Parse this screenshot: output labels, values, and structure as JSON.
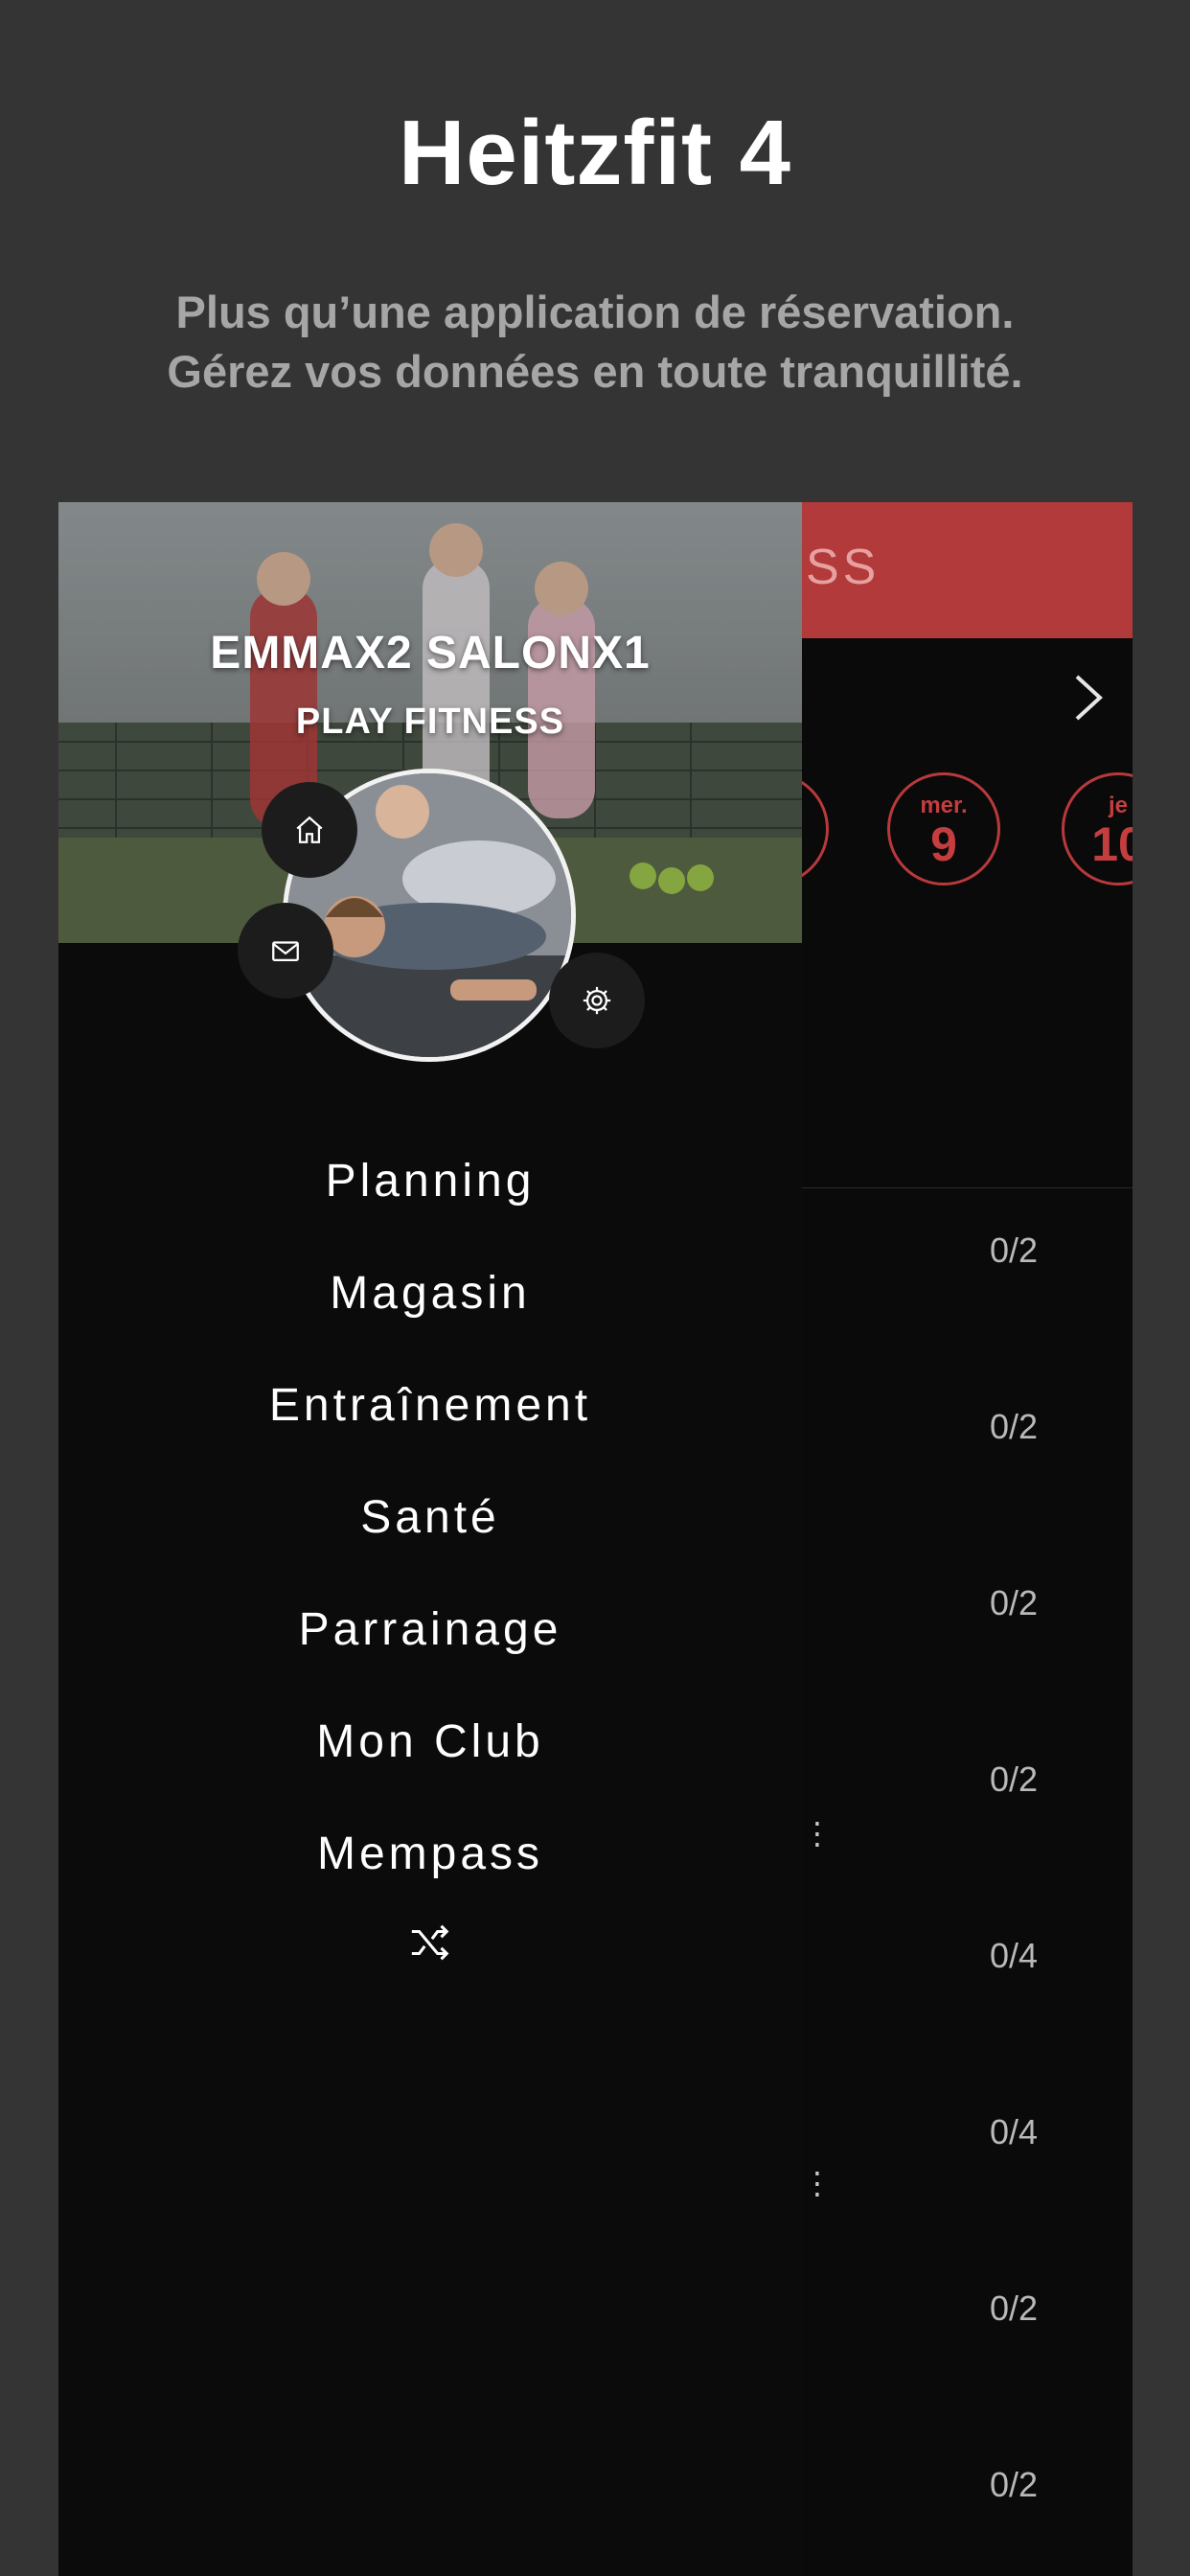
{
  "promo": {
    "title": "Heitzfit 4",
    "subtitle_line1": "Plus qu’une application de réservation.",
    "subtitle_line2": "Gérez vos données en toute tranquillité."
  },
  "app": {
    "header_title_partial": "SS",
    "days": [
      {
        "weekday": "",
        "day": ""
      },
      {
        "weekday": "mer.",
        "day": "9"
      },
      {
        "weekday": "je",
        "day": "10"
      }
    ],
    "slots": [
      "0/2",
      "0/2",
      "0/2",
      "0/2",
      "0/4",
      "0/4",
      "0/2",
      "0/2"
    ]
  },
  "drawer": {
    "user_name": "EMMAX2 SALONX1",
    "club_name": "PLAY FITNESS",
    "menu": [
      "Planning",
      "Magasin",
      "Entraînement",
      "Santé",
      "Parrainage",
      "Mon Club",
      "Mempass"
    ],
    "icons": [
      "home-icon",
      "mail-icon",
      "gear-icon",
      "shuffle-icon"
    ]
  },
  "colors": {
    "background": "#343434",
    "accent": "#b23a3a",
    "drawer": "#0b0b0b",
    "text": "#ffffff",
    "subtitle": "#a6a6a6"
  }
}
